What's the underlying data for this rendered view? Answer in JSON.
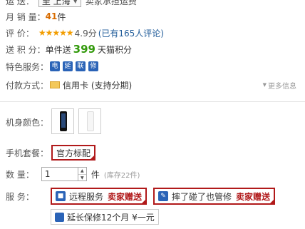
{
  "shipping": {
    "label": "运  送：",
    "select_value": "至 上海",
    "after_text": "卖家承担运费"
  },
  "sales": {
    "label": "月 销 量：",
    "count": "41",
    "unit": "件"
  },
  "rating": {
    "label": "评      价：",
    "stars": "★★★★★",
    "score": "4.9分",
    "reviews_text": "(已有165人评论)"
  },
  "points": {
    "label": "送 积 分：",
    "prefix": "单件送",
    "amount": "399",
    "suffix": "天猫积分"
  },
  "services": {
    "label": "特色服务：",
    "icons": [
      "电",
      "延",
      "联",
      "修"
    ]
  },
  "payment": {
    "label": "付款方式：",
    "method": "信用卡 (支持分期)",
    "more_info": "更多信息"
  },
  "body_color": {
    "label": "机身颜色：",
    "options": [
      "黑色",
      "白色"
    ]
  },
  "package": {
    "label": "手机套餐：",
    "selected": "官方标配"
  },
  "quantity": {
    "label": "数      量：",
    "value": "1",
    "unit": "件",
    "stock": "(库存22件)"
  },
  "service_opts": {
    "label": "服      务：",
    "items": [
      {
        "name": "远程服务",
        "tag": "卖家赠送"
      },
      {
        "name": "摔了碰了也管修",
        "tag": "卖家赠送"
      }
    ],
    "warranty": "延长保修12个月 ¥一元"
  },
  "colors": {
    "accent_red": "#b1191a",
    "points_green": "#339a0c",
    "service_blue": "#2a63b7"
  }
}
